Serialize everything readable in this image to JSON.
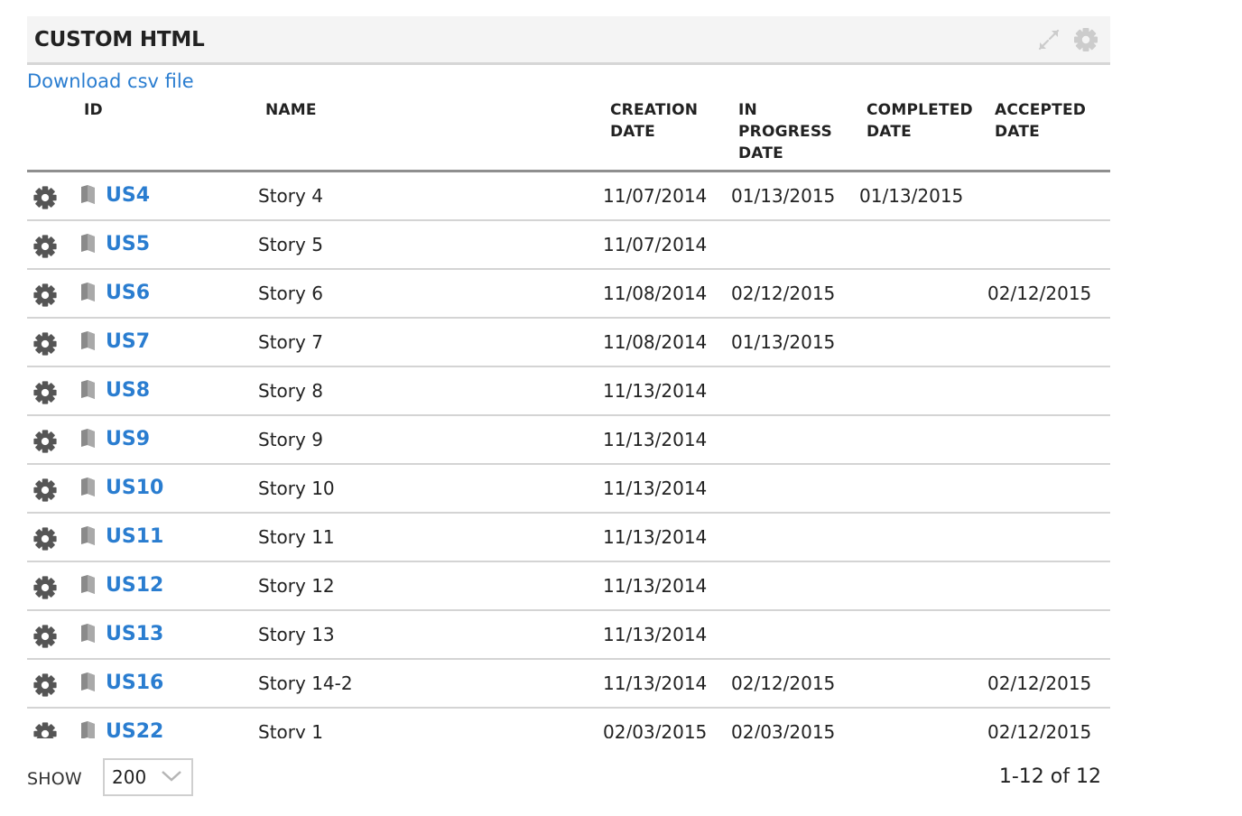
{
  "panel": {
    "title": "CUSTOM HTML"
  },
  "download_link": "Download csv file",
  "columns": {
    "id": "ID",
    "name": "NAME",
    "creation": [
      "CREATION",
      "DATE"
    ],
    "in_progress": [
      "IN",
      "PROGRESS",
      "DATE"
    ],
    "completed": [
      "COMPLETED",
      "DATE"
    ],
    "accepted": [
      "ACCEPTED",
      "DATE"
    ]
  },
  "rows": [
    {
      "id": "US4",
      "name": "Story 4",
      "creation": "11/07/2014",
      "in_progress": "01/13/2015",
      "completed": "01/13/2015",
      "accepted": ""
    },
    {
      "id": "US5",
      "name": "Story 5",
      "creation": "11/07/2014",
      "in_progress": "",
      "completed": "",
      "accepted": ""
    },
    {
      "id": "US6",
      "name": "Story 6",
      "creation": "11/08/2014",
      "in_progress": "02/12/2015",
      "completed": "",
      "accepted": "02/12/2015"
    },
    {
      "id": "US7",
      "name": "Story 7",
      "creation": "11/08/2014",
      "in_progress": "01/13/2015",
      "completed": "",
      "accepted": ""
    },
    {
      "id": "US8",
      "name": "Story 8",
      "creation": "11/13/2014",
      "in_progress": "",
      "completed": "",
      "accepted": ""
    },
    {
      "id": "US9",
      "name": "Story 9",
      "creation": "11/13/2014",
      "in_progress": "",
      "completed": "",
      "accepted": ""
    },
    {
      "id": "US10",
      "name": "Story 10",
      "creation": "11/13/2014",
      "in_progress": "",
      "completed": "",
      "accepted": ""
    },
    {
      "id": "US11",
      "name": "Story 11",
      "creation": "11/13/2014",
      "in_progress": "",
      "completed": "",
      "accepted": ""
    },
    {
      "id": "US12",
      "name": "Story 12",
      "creation": "11/13/2014",
      "in_progress": "",
      "completed": "",
      "accepted": ""
    },
    {
      "id": "US13",
      "name": "Story 13",
      "creation": "11/13/2014",
      "in_progress": "",
      "completed": "",
      "accepted": ""
    },
    {
      "id": "US16",
      "name": "Story 14-2",
      "creation": "11/13/2014",
      "in_progress": "02/12/2015",
      "completed": "",
      "accepted": "02/12/2015"
    },
    {
      "id": "US22",
      "name": "Story 1",
      "creation": "02/03/2015",
      "in_progress": "02/03/2015",
      "completed": "",
      "accepted": "02/12/2015"
    }
  ],
  "footer": {
    "show_label": "SHOW",
    "page_size": "200",
    "page_count": "1-12 of 12"
  },
  "icons": {
    "row_action": "gear-icon",
    "row_type": "user-story-icon",
    "expand": "expand-icon",
    "settings": "gear-icon",
    "dropdown": "chevron-down-icon"
  },
  "colors": {
    "link": "#2a7dd0",
    "header_bg": "#f4f4f4",
    "icon_gray": "#555555"
  }
}
